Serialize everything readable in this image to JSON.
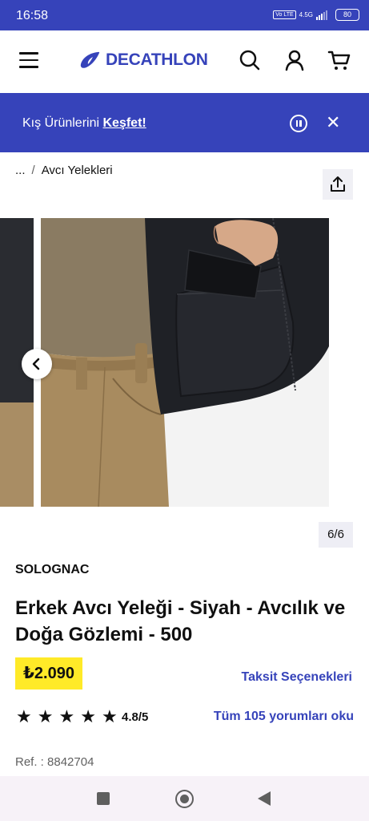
{
  "status_bar": {
    "time": "16:58",
    "volte": "Vo LTE",
    "network": "4.5G",
    "battery": "80"
  },
  "header": {
    "logo_text": "DECATHLON",
    "icons": [
      "menu-icon",
      "search-icon",
      "account-icon",
      "cart-icon"
    ]
  },
  "promo": {
    "text": "Kış Ürünlerini ",
    "link": "Keşfet!"
  },
  "breadcrumb": {
    "ellipsis": "...",
    "separator": "/",
    "current": "Avcı Yelekleri"
  },
  "gallery": {
    "counter": "6/6"
  },
  "product": {
    "brand": "SOLOGNAC",
    "title": "Erkek Avcı Yeleği - Siyah - Avcılık ve Doğa Gözlemi - 500",
    "price": "₺2.090",
    "installments": "Taksit Seçenekleri",
    "stars": 5,
    "rating": "4.8/5",
    "reviews_link": "Tüm 105 yorumları oku",
    "ref": "Ref. : 8842704"
  },
  "colors": {
    "brand_blue": "#3643ba",
    "price_yellow": "#ffea28"
  }
}
